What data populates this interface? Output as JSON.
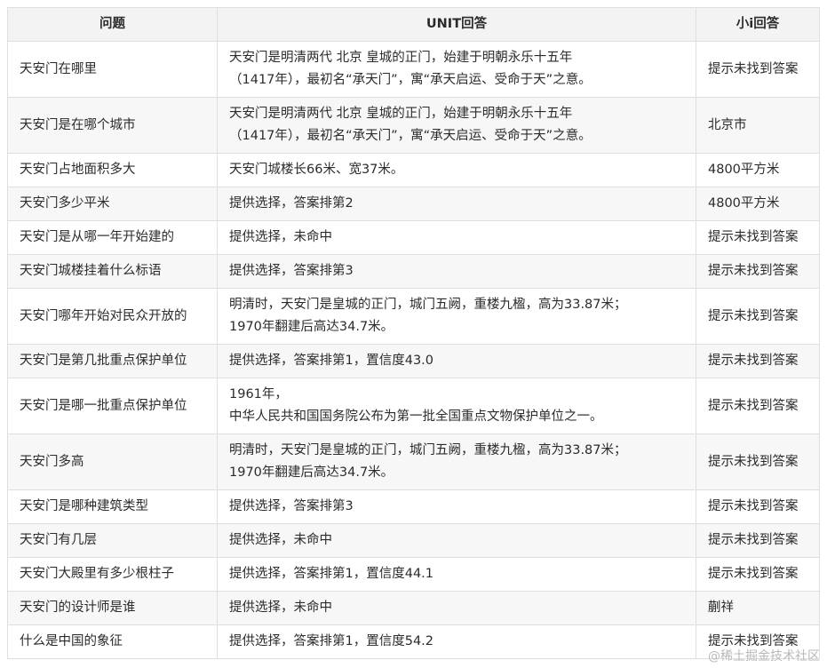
{
  "headers": [
    "问题",
    "UNIT回答",
    "小i回答"
  ],
  "rows": [
    {
      "q": "天安门在哪里",
      "u": [
        "天安门是明清两代 北京 皇城的正门，始建于明朝永乐十五年",
        "（1417年），最初名“承天门”，寓“承天启运、受命于天”之意。"
      ],
      "x": "提示未找到答案"
    },
    {
      "q": "天安门是在哪个城市",
      "u": [
        "天安门是明清两代 北京 皇城的正门，始建于明朝永乐十五年",
        "（1417年），最初名“承天门”，寓“承天启运、受命于天”之意。"
      ],
      "x": "北京市"
    },
    {
      "q": "天安门占地面积多大",
      "u": [
        "天安门城楼长66米、宽37米。"
      ],
      "x": "4800平方米"
    },
    {
      "q": "天安门多少平米",
      "u": [
        "提供选择，答案排第2"
      ],
      "x": "4800平方米"
    },
    {
      "q": "天安门是从哪一年开始建的",
      "u": [
        "提供选择，未命中"
      ],
      "x": "提示未找到答案"
    },
    {
      "q": "天安门城楼挂着什么标语",
      "u": [
        "提供选择，答案排第3"
      ],
      "x": "提示未找到答案"
    },
    {
      "q": "天安门哪年开始对民众开放的",
      "u": [
        "明清时，天安门是皇城的正门，城门五阙，重楼九楹，高为33.87米；",
        "1970年翻建后高达34.7米。"
      ],
      "x": "提示未找到答案"
    },
    {
      "q": "天安门是第几批重点保护单位",
      "u": [
        "提供选择，答案排第1，置信度43.0"
      ],
      "x": "提示未找到答案"
    },
    {
      "q": "天安门是哪一批重点保护单位",
      "u": [
        "1961年，",
        "中华人民共和国国务院公布为第一批全国重点文物保护单位之一。"
      ],
      "x": "提示未找到答案"
    },
    {
      "q": "天安门多高",
      "u": [
        "明清时，天安门是皇城的正门，城门五阙，重楼九楹，高为33.87米；",
        "1970年翻建后高达34.7米。"
      ],
      "x": "提示未找到答案"
    },
    {
      "q": "天安门是哪种建筑类型",
      "u": [
        "提供选择，答案排第3"
      ],
      "x": "提示未找到答案"
    },
    {
      "q": "天安门有几层",
      "u": [
        "提供选择，未命中"
      ],
      "x": "提示未找到答案"
    },
    {
      "q": "天安门大殿里有多少根柱子",
      "u": [
        "提供选择，答案排第1，置信度44.1"
      ],
      "x": "提示未找到答案"
    },
    {
      "q": "天安门的设计师是谁",
      "u": [
        "提供选择，未命中"
      ],
      "x": "蒯祥"
    },
    {
      "q": "什么是中国的象征",
      "u": [
        "提供选择，答案排第1，置信度54.2"
      ],
      "x": "提示未找到答案"
    }
  ],
  "watermark": "@稀土掘金技术社区"
}
